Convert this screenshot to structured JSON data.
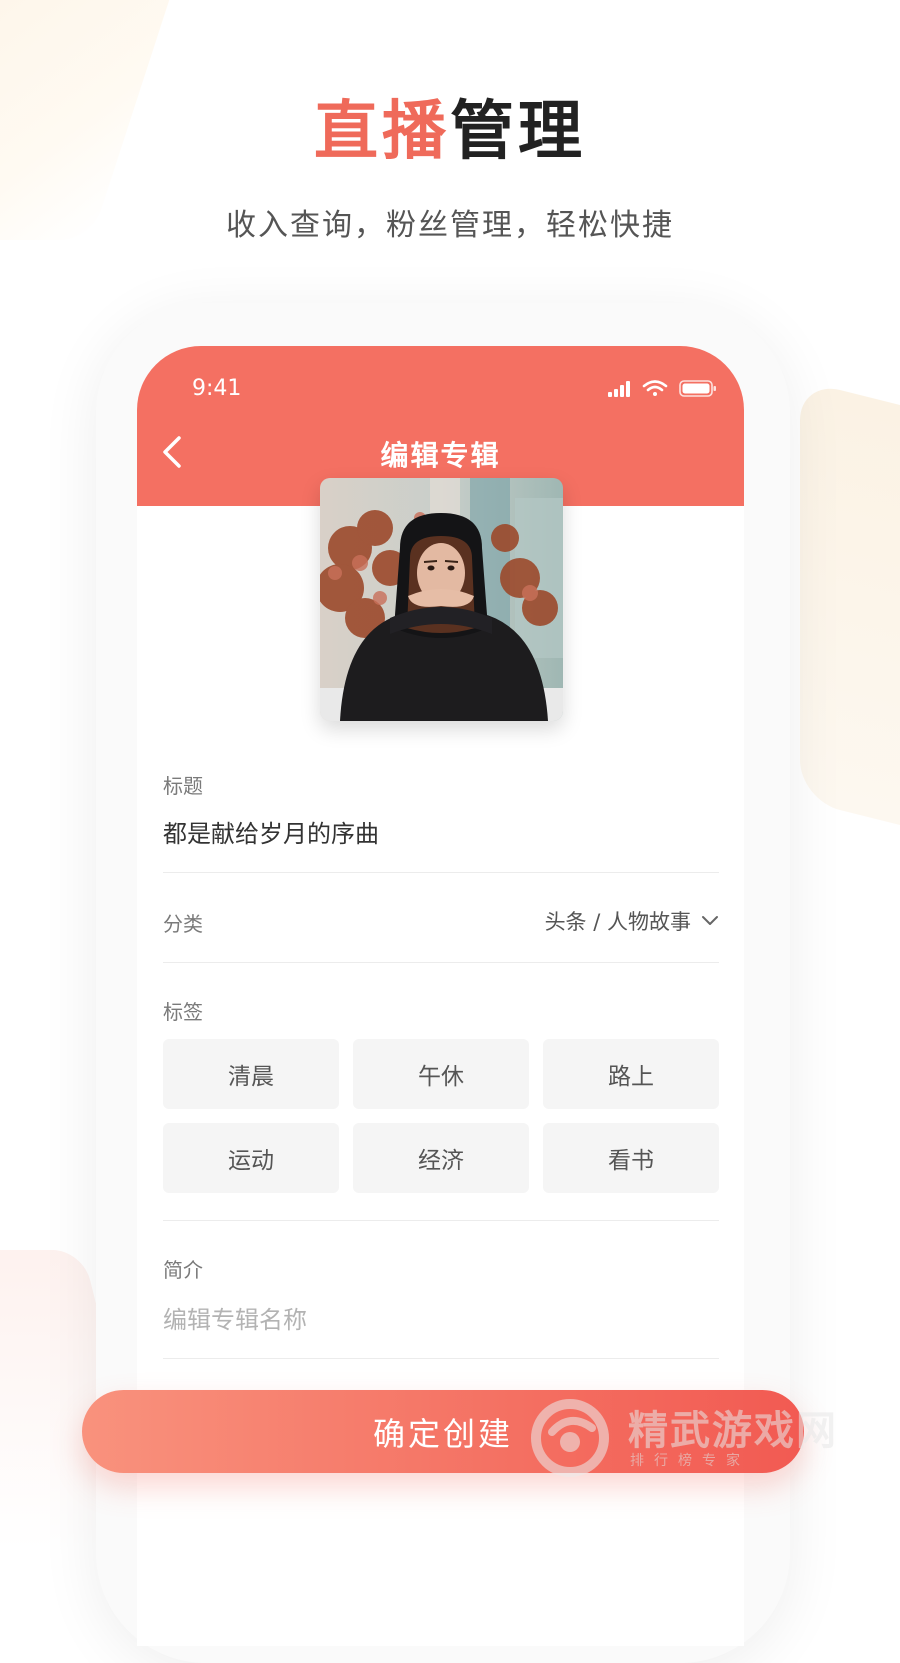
{
  "hero": {
    "title_accent": "直播",
    "title_rest": "管理",
    "subtitle": "收入查询，粉丝管理，轻松快捷"
  },
  "status_bar": {
    "time": "9:41",
    "icons": [
      "signal-icon",
      "wifi-icon",
      "battery-icon"
    ]
  },
  "nav": {
    "back_icon": "chevron-left-icon",
    "title": "编辑专辑"
  },
  "cover": {
    "image": "album-cover-photo"
  },
  "form": {
    "title_label": "标题",
    "title_value": "都是献给岁月的序曲",
    "category_label": "分类",
    "category_value": "头条 / 人物故事",
    "tags_label": "标签",
    "tags": [
      "清晨",
      "午休",
      "路上",
      "运动",
      "经济",
      "看书"
    ],
    "intro_label": "简介",
    "intro_placeholder": "编辑专辑名称"
  },
  "cta": {
    "label": "确定创建"
  },
  "watermark": {
    "name": "精武游戏网",
    "tagline": "排行榜专家"
  },
  "colors": {
    "accent": "#f47062",
    "hero_accent": "#ef6a5a",
    "text_dark": "#333333",
    "text_muted": "#7a7a7a"
  }
}
